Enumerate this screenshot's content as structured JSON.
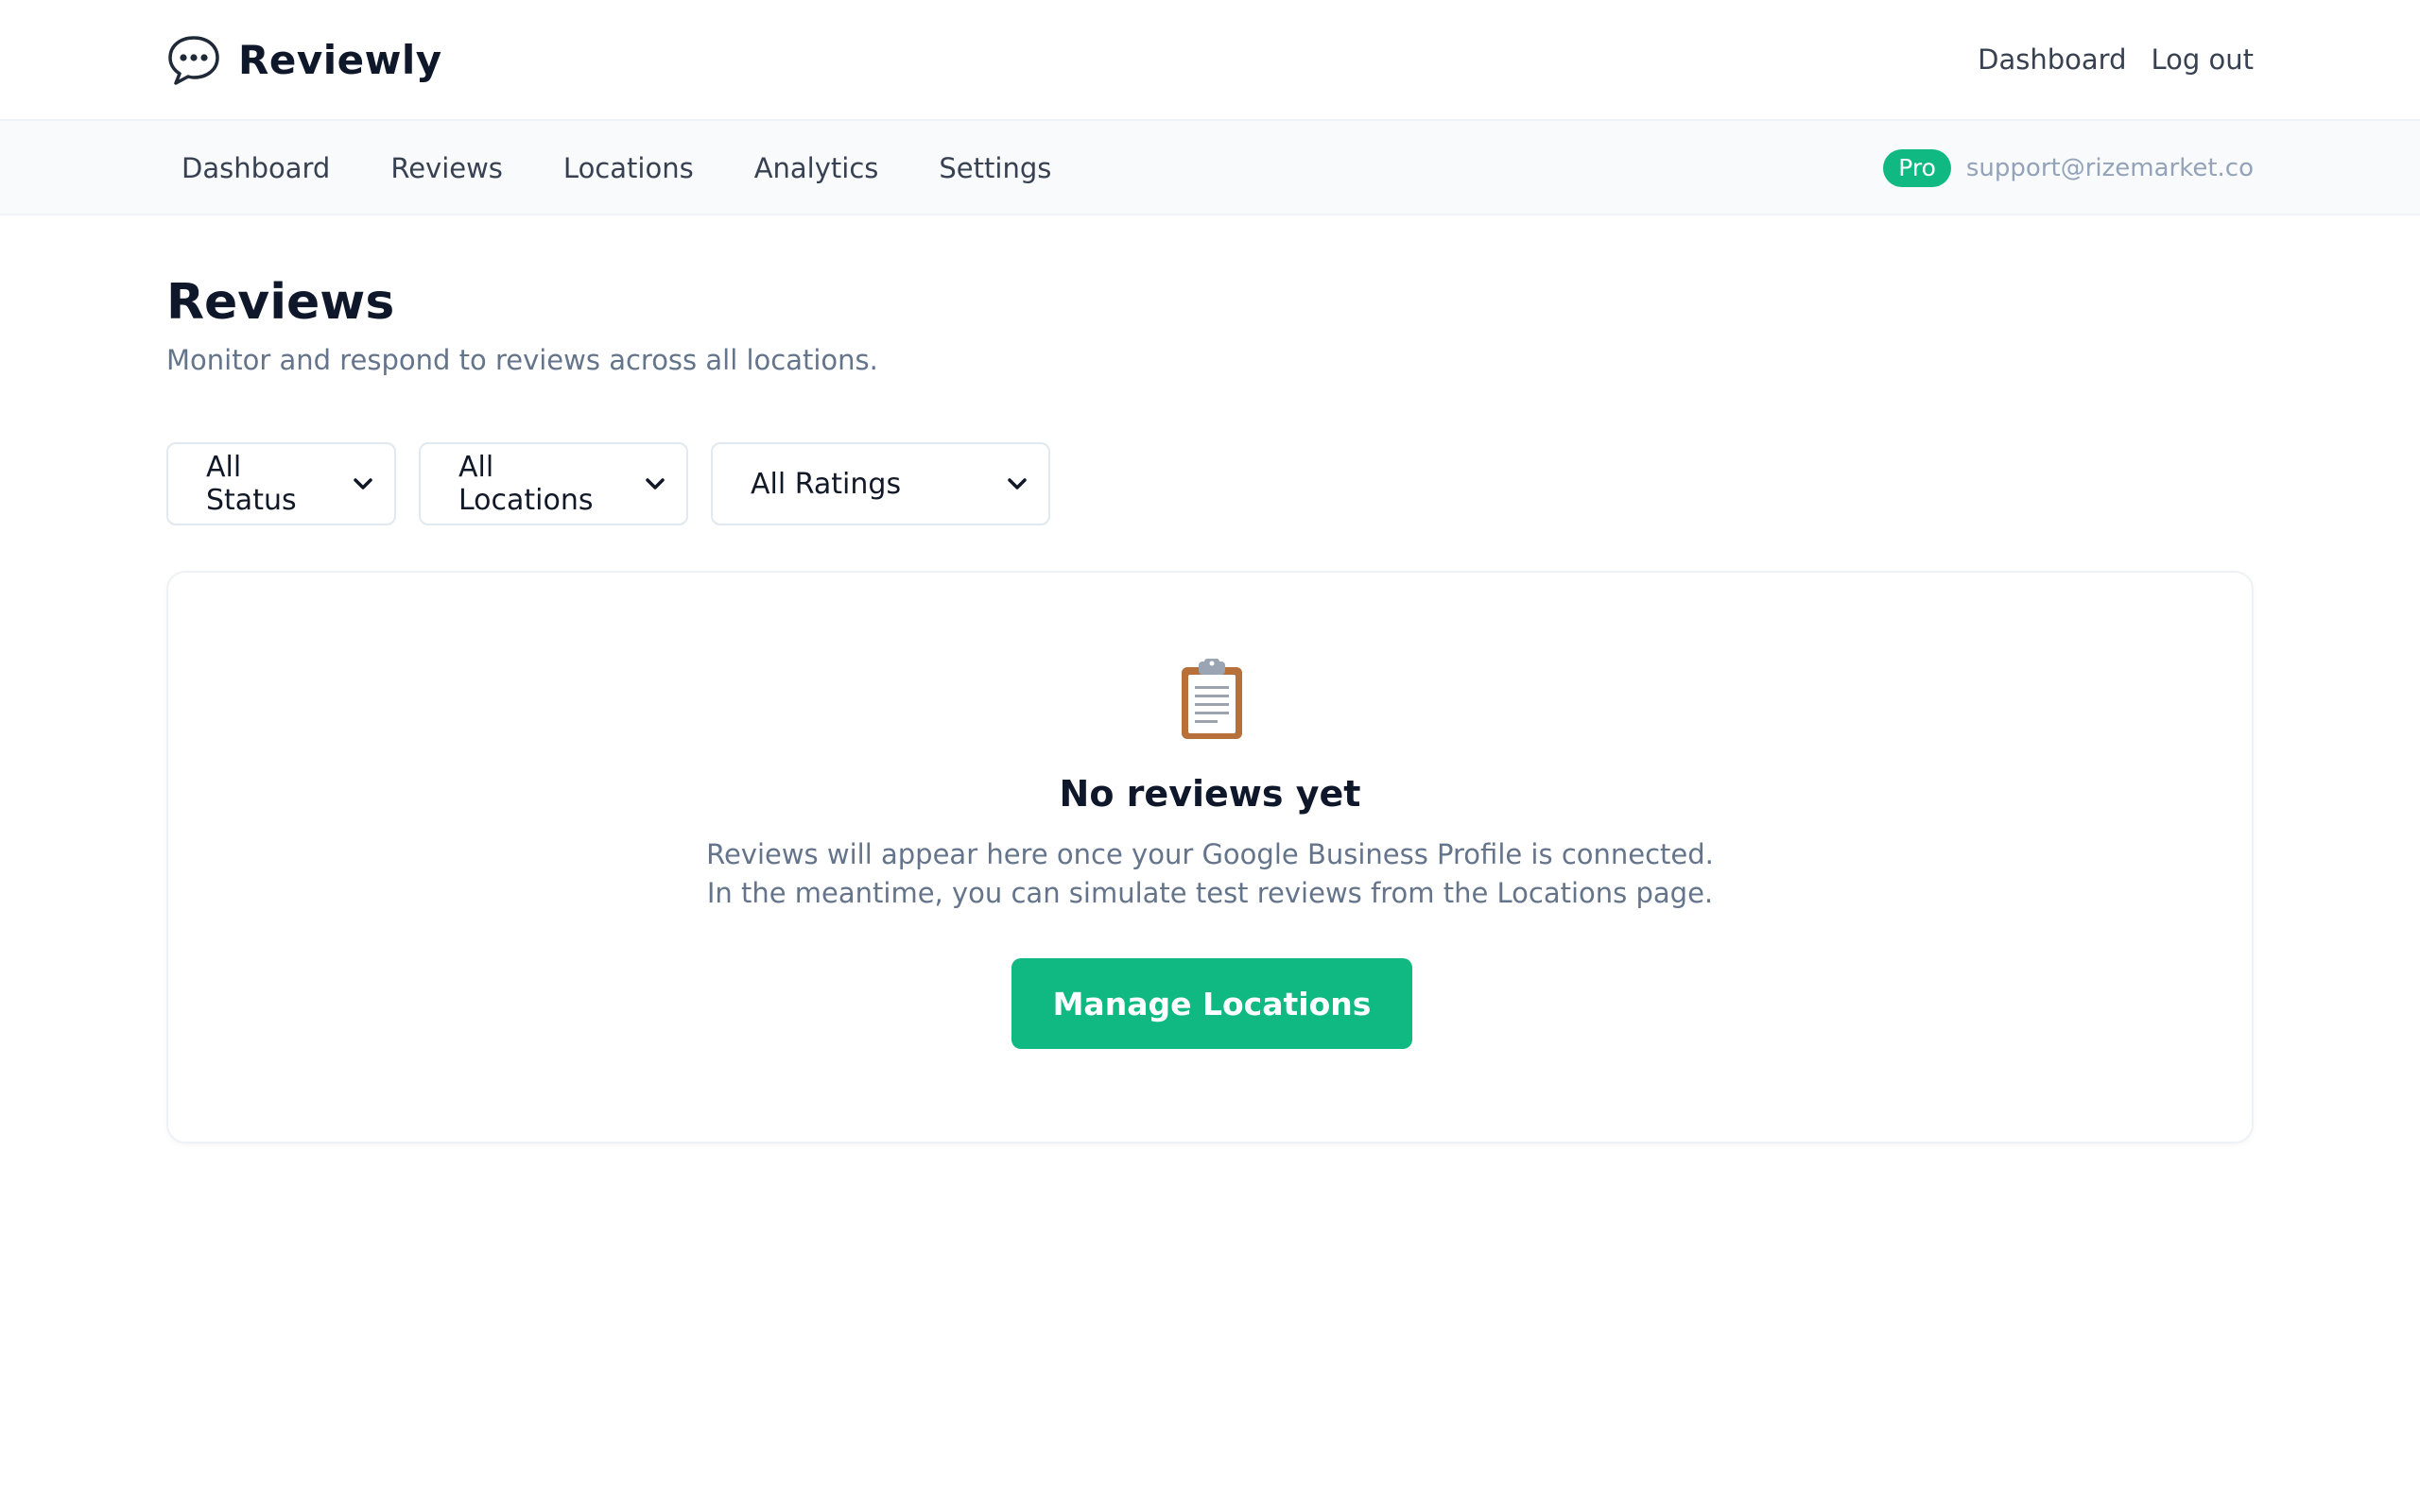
{
  "brand": {
    "name": "Reviewly",
    "icon": "speech-bubble-icon"
  },
  "top_links": [
    {
      "label": "Dashboard"
    },
    {
      "label": "Log out"
    }
  ],
  "nav": {
    "items": [
      {
        "label": "Dashboard"
      },
      {
        "label": "Reviews"
      },
      {
        "label": "Locations"
      },
      {
        "label": "Analytics"
      },
      {
        "label": "Settings"
      }
    ],
    "plan_badge": "Pro",
    "email": "support@rizemarket.co"
  },
  "page": {
    "title": "Reviews",
    "subtitle": "Monitor and respond to reviews across all locations."
  },
  "filters": {
    "status": {
      "selected": "All Status"
    },
    "locations": {
      "selected": "All Locations"
    },
    "ratings": {
      "selected": "All Ratings"
    }
  },
  "empty_state": {
    "icon": "clipboard-icon",
    "title": "No reviews yet",
    "line1": "Reviews will appear here once your Google Business Profile is connected.",
    "line2": "In the meantime, you can simulate test reviews from the Locations page.",
    "cta_label": "Manage Locations"
  },
  "colors": {
    "accent": "#10b981",
    "text_primary": "#0f172a",
    "text_muted": "#64748b",
    "subnav_bg": "#f8fafc"
  }
}
